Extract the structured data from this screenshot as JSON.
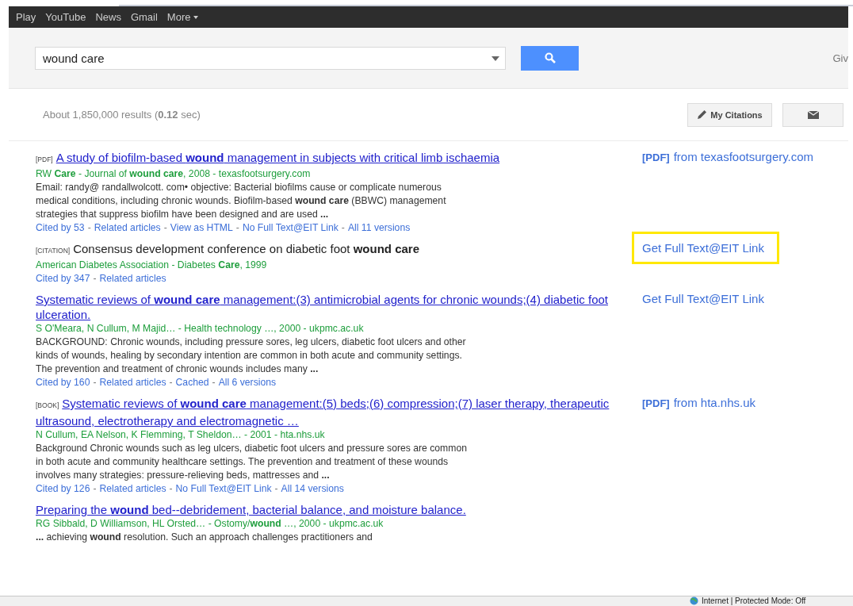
{
  "top_nav": [
    "Play",
    "YouTube",
    "News",
    "Gmail",
    "More"
  ],
  "search": {
    "value": "wound care",
    "side_text": "Giv"
  },
  "results_stats": "About 1,850,000 results (**0.12** sec)",
  "toolbar": {
    "citations_button": "My Citations"
  },
  "link_separator": "-",
  "results": [
    {
      "kind": "link",
      "tag": "[PDF]",
      "title": "A study of biofilm-based **wound** management in subjects with critical limb ischaemia",
      "authors": "RW **Care** - Journal of **wound care**, 2008 - texasfootsurgery.com",
      "snippet": "Email: randy@ randallwolcott. com• objective: Bacterial biofilms cause or complicate numerous medical conditions, including chronic wounds. Biofilm-based **wound care** (BBWC) management strategies that suppress biofilm have been designed and are used **...**",
      "links": [
        "Cited by 53",
        "Related articles",
        "View as HTML",
        "No Full Text@EIT Link",
        "All 11 versions"
      ],
      "side": {
        "tag": "[PDF]",
        "text": "from texasfootsurgery.com",
        "highlighted": false
      }
    },
    {
      "kind": "citation",
      "tag": "[CITATION]",
      "title": "Consensus development conference on diabetic foot **wound care**",
      "authors": "American Diabetes Association - Diabetes **Care**, 1999",
      "links": [
        "Cited by 347",
        "Related articles"
      ],
      "side": {
        "text": "Get Full Text@EIT Link",
        "highlighted": true
      }
    },
    {
      "kind": "link",
      "title": "Systematic reviews of **wound care** management:(3) antimicrobial agents for chronic wounds;(4) diabetic foot ulceration.",
      "authors": "S O'Meara, N Cullum, M Majid… - Health technology …, 2000 - ukpmc.ac.uk",
      "snippet": "BACKGROUND: Chronic wounds, including pressure sores, leg ulcers, diabetic foot ulcers and other kinds of wounds, healing by secondary intention are common in both acute and community settings. The prevention and treatment of chronic wounds includes many **...**",
      "links": [
        "Cited by 160",
        "Related articles",
        "Cached",
        "All 6 versions"
      ],
      "side": {
        "text": "Get Full Text@EIT Link",
        "highlighted": false
      }
    },
    {
      "kind": "link",
      "tag": "[BOOK]",
      "title": "Systematic reviews of **wound care** management:(5) beds;(6) compression;(7) laser therapy, therapeutic ultrasound, electrotherapy and electromagnetic …",
      "authors": "N Cullum, EA Nelson, K Flemming, T Sheldon… - 2001 - hta.nhs.uk",
      "snippet": "Background Chronic wounds such as leg ulcers, diabetic foot ulcers and pressure sores are common in both acute and community healthcare settings. The prevention and treatment of these wounds involves many strategies: pressure-relieving beds, mattresses and **...**",
      "links": [
        "Cited by 126",
        "Related articles",
        "No Full Text@EIT Link",
        "All 14 versions"
      ],
      "side": {
        "tag": "[PDF]",
        "text": "from hta.nhs.uk",
        "highlighted": false
      }
    },
    {
      "kind": "link",
      "title": "Preparing the **wound** bed--debridement, bacterial balance, and moisture balance.",
      "authors": "RG Sibbald, D Williamson, HL Orsted… - Ostomy/**wound** …, 2000 - ukpmc.ac.uk",
      "snippet": "**...** achieving **wound** resolution. Such an approach challenges practitioners and"
    }
  ],
  "status_bar": {
    "text": "Internet | Protected Mode: Off"
  }
}
